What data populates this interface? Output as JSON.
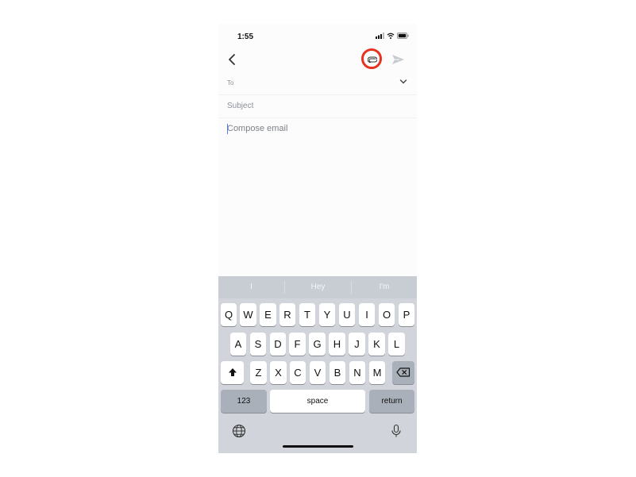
{
  "status_bar": {
    "time": "1:55",
    "icons": [
      "signal-icon",
      "wifi-icon",
      "battery-icon"
    ]
  },
  "toolbar": {
    "back_icon": "chevron-left-icon",
    "attach_icon": "paperclip-icon",
    "attach_highlight_color": "#e8321f",
    "send_icon": "send-icon"
  },
  "compose": {
    "to_label": "To",
    "subject_placeholder": "Subject",
    "body_placeholder": "Compose email"
  },
  "keyboard": {
    "suggestions": [
      "I",
      "Hey",
      "I'm"
    ],
    "row1": [
      "Q",
      "W",
      "E",
      "R",
      "T",
      "Y",
      "U",
      "I",
      "O",
      "P"
    ],
    "row2": [
      "A",
      "S",
      "D",
      "F",
      "G",
      "H",
      "J",
      "K",
      "L"
    ],
    "row3": [
      "Z",
      "X",
      "C",
      "V",
      "B",
      "N",
      "M"
    ],
    "numbers_label": "123",
    "space_label": "space",
    "return_label": "return"
  }
}
